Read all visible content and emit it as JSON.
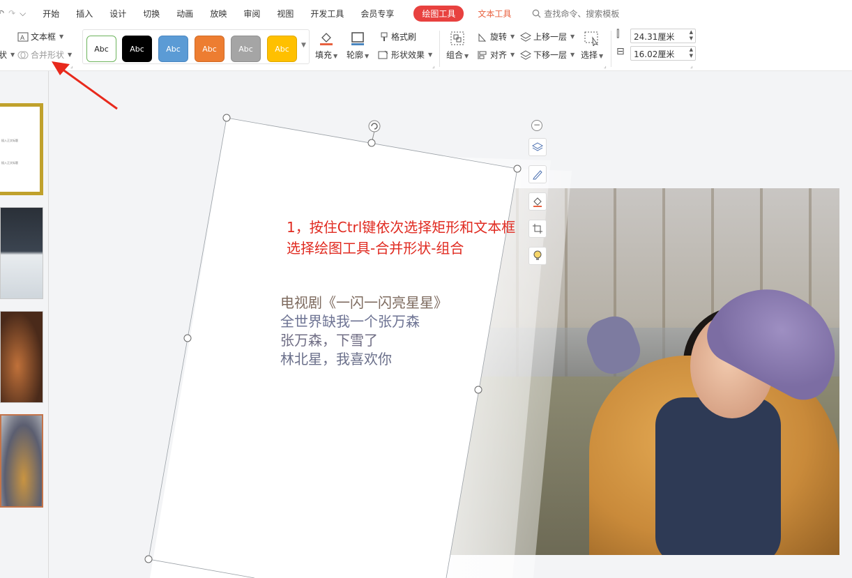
{
  "menubar": {
    "quick_access": [
      "↶",
      "↷",
      "⌵"
    ],
    "tabs": [
      "开始",
      "插入",
      "设计",
      "切换",
      "动画",
      "放映",
      "审阅",
      "视图",
      "开发工具",
      "会员专享"
    ],
    "active_tab": "绘图工具",
    "secondary_tab": "文本工具",
    "search_placeholder": "查找命令、搜索模板"
  },
  "ribbon": {
    "shape_label_partial": "状",
    "text_box": "文本框",
    "merge_shapes": "合并形状",
    "style_swatches": [
      {
        "label": "Abc",
        "bg": "#ffffff",
        "fg": "#222222",
        "border": "#6cb35b"
      },
      {
        "label": "Abc",
        "bg": "#000000",
        "fg": "#ffffff",
        "border": "#000000"
      },
      {
        "label": "Abc",
        "bg": "#5b9bd5",
        "fg": "#ffffff",
        "border": "#4a86c0"
      },
      {
        "label": "Abc",
        "bg": "#ed7d31",
        "fg": "#ffffff",
        "border": "#d06a26"
      },
      {
        "label": "Abc",
        "bg": "#a5a5a5",
        "fg": "#ffffff",
        "border": "#8f8f8f"
      },
      {
        "label": "Abc",
        "bg": "#ffc000",
        "fg": "#ffffff",
        "border": "#e0a800"
      }
    ],
    "fill": "填充",
    "outline": "轮廓",
    "format_painter": "格式刷",
    "shape_effects": "形状效果",
    "group": "组合",
    "rotate": "旋转",
    "align": "对齐",
    "bring_forward": "上移一层",
    "send_backward": "下移一层",
    "select": "选择",
    "height_value": "24.31厘米",
    "width_value": "16.02厘米"
  },
  "thumbnail_lines": [
    "插入正文标题",
    "插入正文标题"
  ],
  "slide": {
    "note_line1": "1，按住Ctrl键依次选择矩形和文本框",
    "note_line2": "选择绘图工具-合并形状-组合",
    "poem": [
      "电视剧《一闪一闪亮星星》",
      "全世界缺我一个张万森",
      "张万森，下雪了",
      "林北星，我喜欢你"
    ]
  },
  "colors": {
    "accent_red": "#e8413f",
    "note_red": "#e02a20",
    "poem_text": "#7a6f88"
  },
  "icons": [
    "undo-icon",
    "redo-icon",
    "textbox-icon",
    "merge-shapes-icon",
    "fill-icon",
    "outline-icon",
    "format-painter-icon",
    "shape-effects-icon",
    "group-icon",
    "rotate-icon",
    "align-icon",
    "bring-forward-icon",
    "send-backward-icon",
    "select-icon",
    "height-icon",
    "width-icon",
    "search-icon",
    "layers-icon",
    "pen-icon",
    "fill-bucket-icon",
    "crop-icon",
    "bulb-icon",
    "minus-icon",
    "rotate-handle-icon"
  ]
}
